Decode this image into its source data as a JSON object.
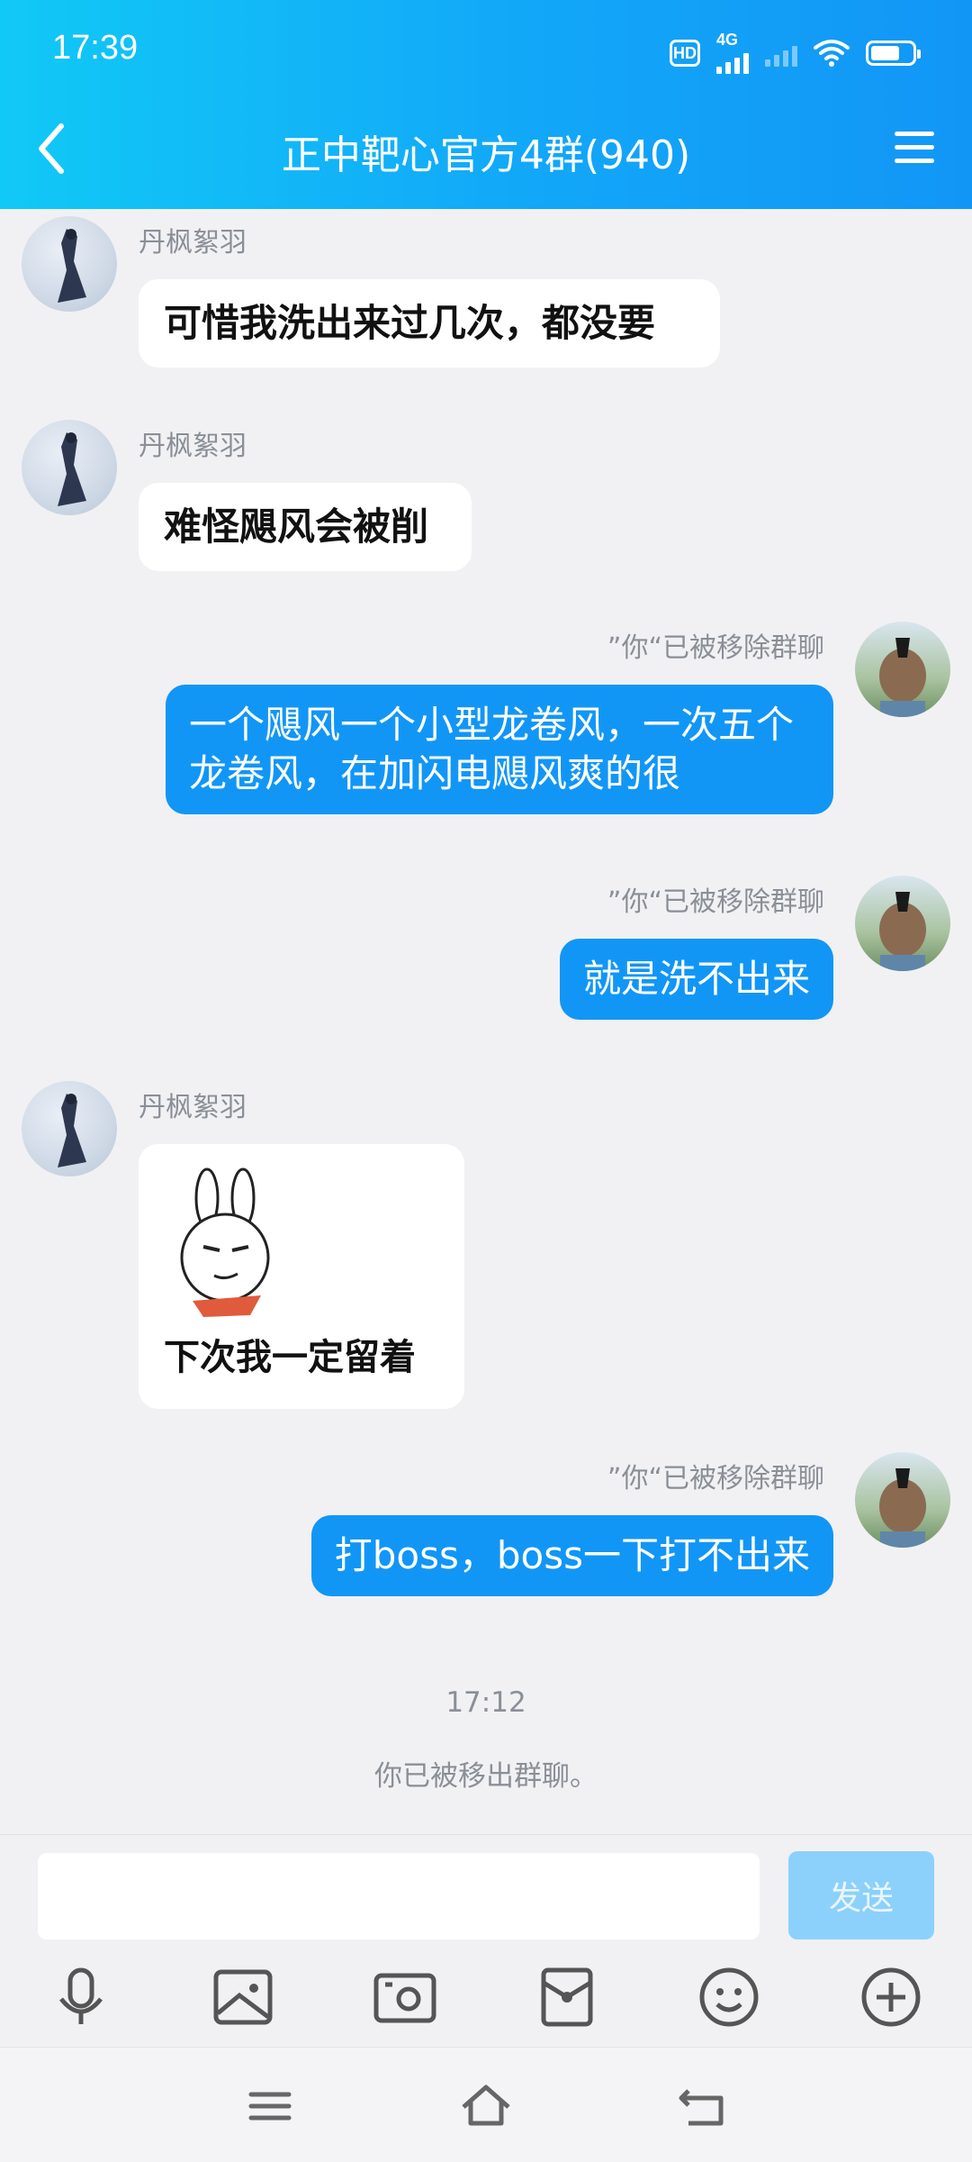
{
  "status_bar": {
    "time": "17:39",
    "hd": "HD",
    "network": "4G"
  },
  "header": {
    "title": "正中靶心官方4群(940)"
  },
  "messages": [
    {
      "sender": "丹枫絮羽",
      "text": "可惜我洗出来过几次，都没要"
    },
    {
      "sender": "丹枫絮羽",
      "text": "难怪飓风会被削"
    },
    {
      "removed_label": "”你“已被移除群聊",
      "text": "一个飓风一个小型龙卷风，一次五个龙卷风，在加闪电飓风爽的很"
    },
    {
      "removed_label": "”你“已被移除群聊",
      "text": "就是洗不出来"
    },
    {
      "sender": "丹枫絮羽",
      "sticker_caption": "下次我一定留着"
    },
    {
      "removed_label": "”你“已被移除群聊",
      "text": "打boss，boss一下打不出来"
    }
  ],
  "system": {
    "timestamp": "17:12",
    "notice": "你已被移出群聊。"
  },
  "input": {
    "value": "",
    "send_label": "发送"
  },
  "toolbar": [
    "microphone-icon",
    "image-icon",
    "camera-icon",
    "red-packet-icon",
    "emoji-icon",
    "plus-icon"
  ]
}
